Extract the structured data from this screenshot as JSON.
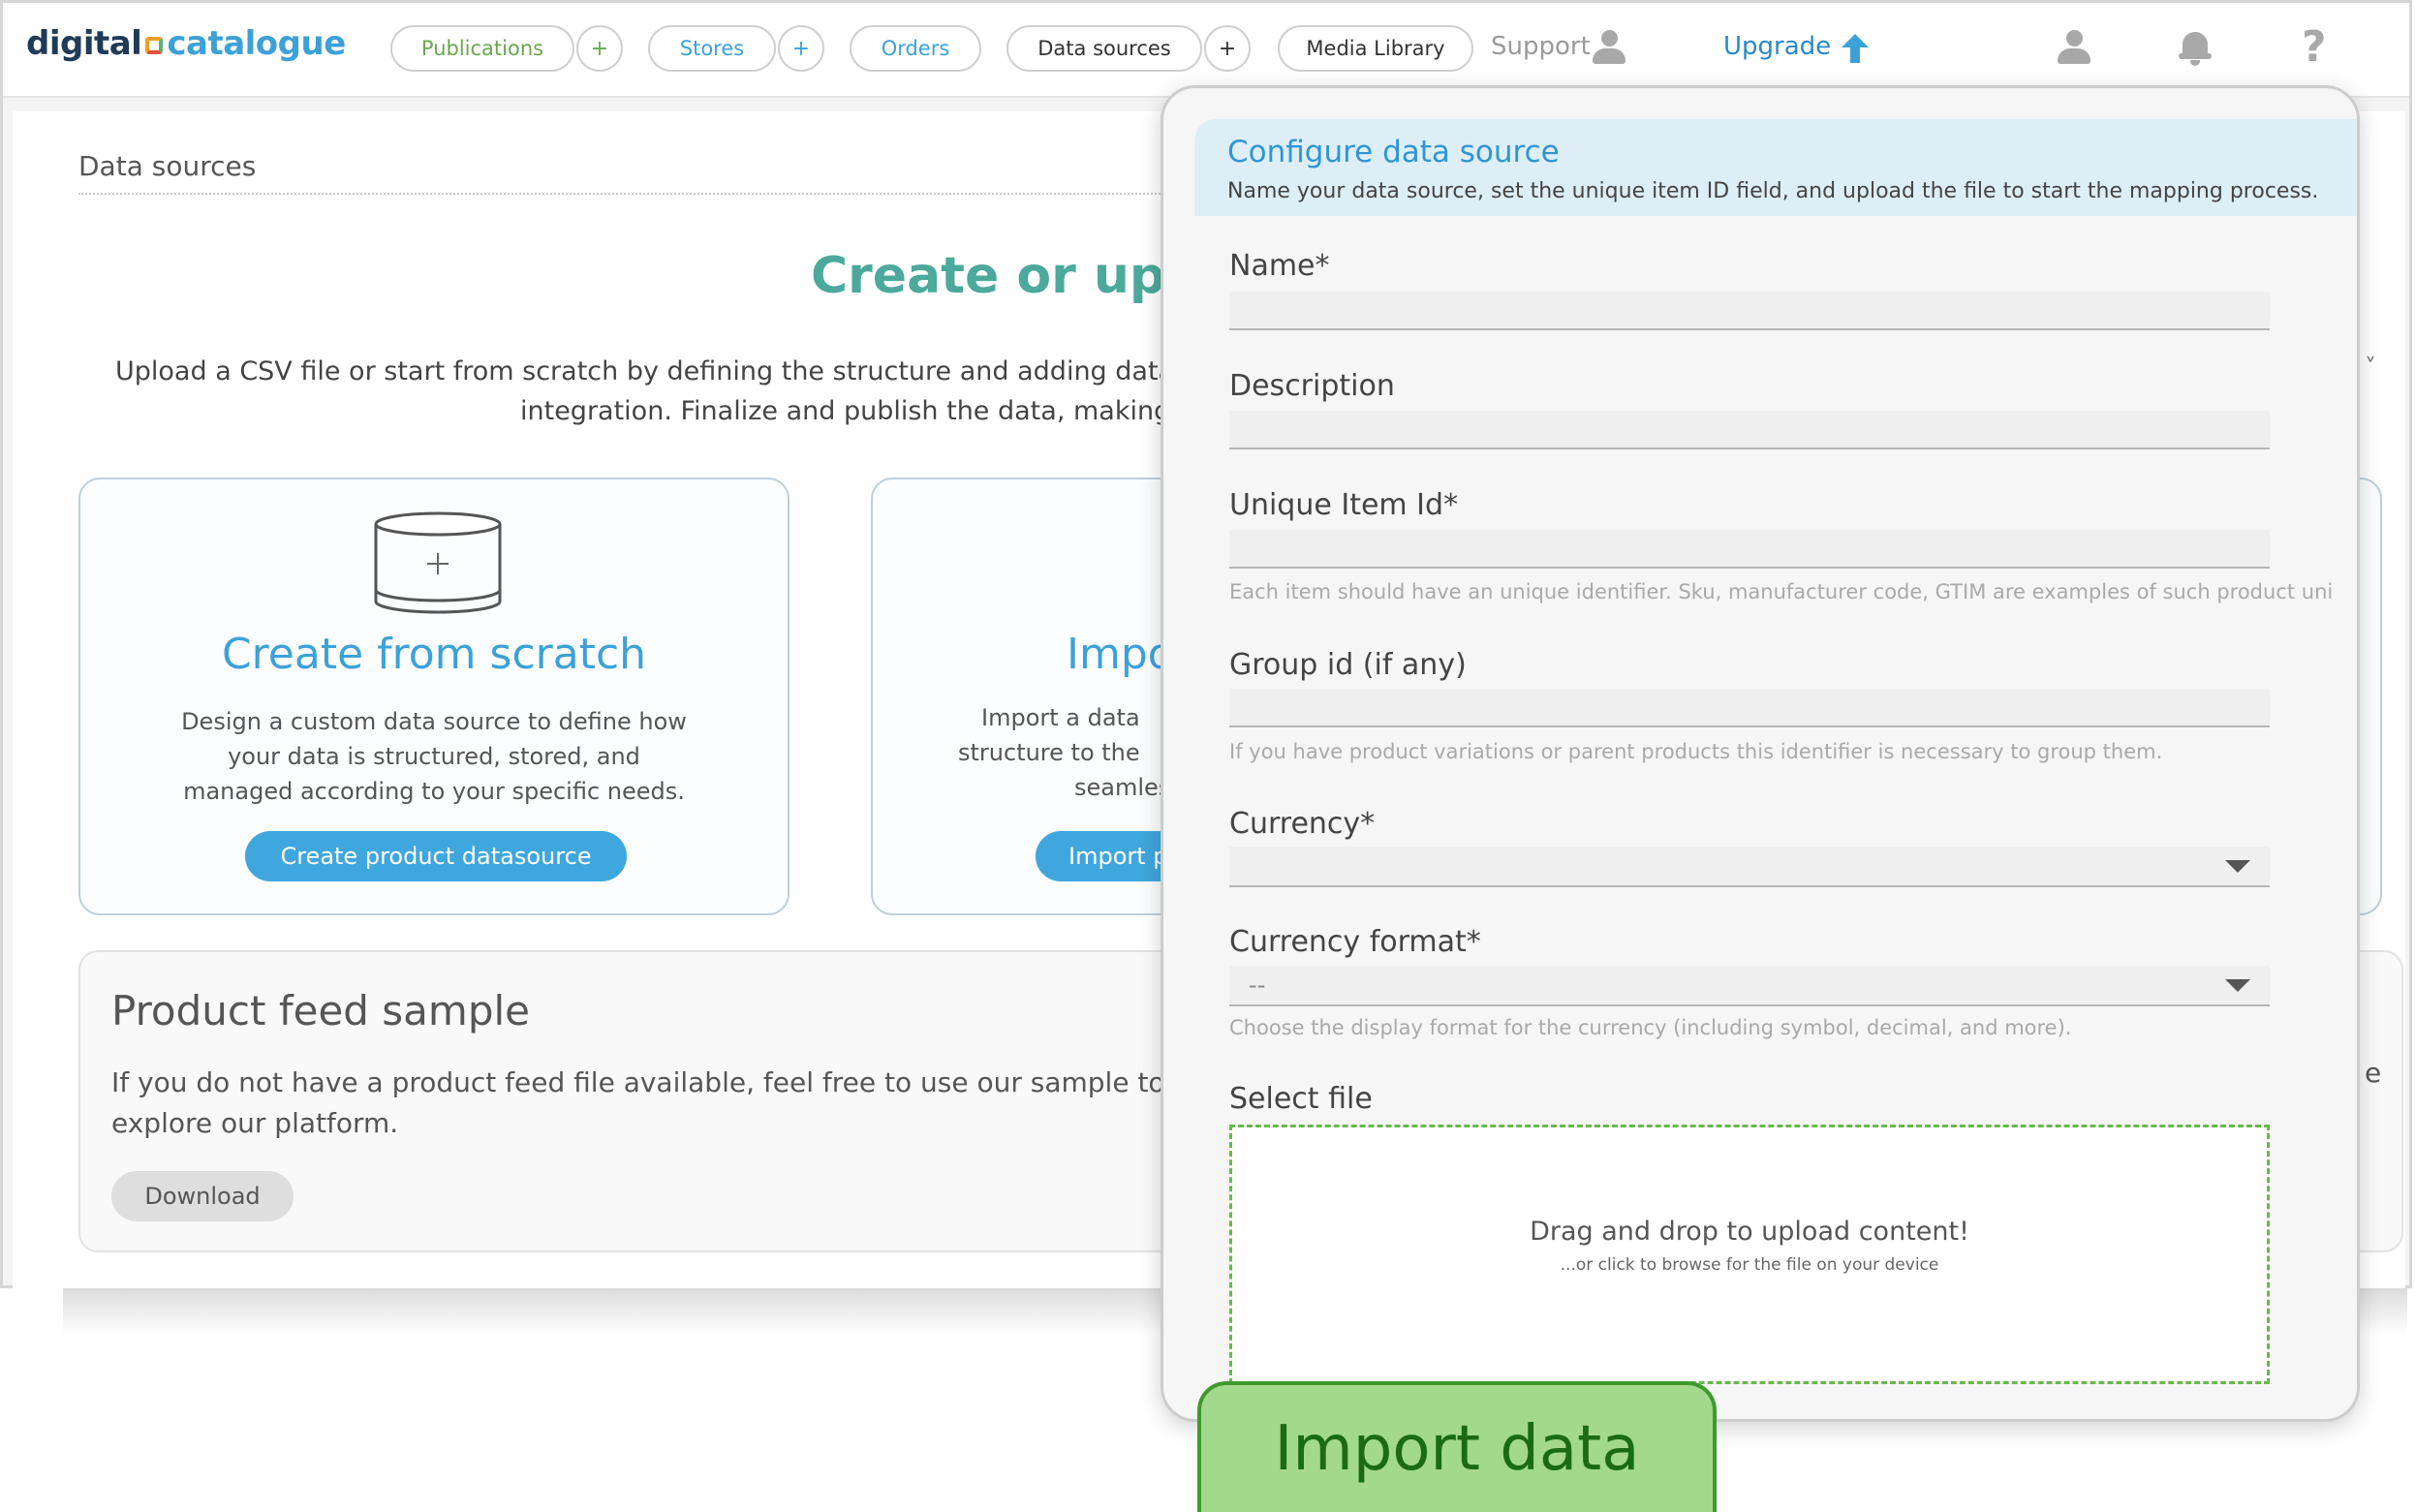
{
  "brand": {
    "part1": "digital",
    "part2": "catalogue"
  },
  "nav": {
    "publications": "Publications",
    "publications_add": "+",
    "stores": "Stores",
    "stores_add": "+",
    "orders": "Orders",
    "data_sources": "Data sources",
    "data_sources_add": "+",
    "media_library": "Media Library",
    "support": "Support",
    "upgrade": "Upgrade",
    "help": "?"
  },
  "colors": {
    "accent_blue": "#3da1d8",
    "hero_teal": "#4ca99b",
    "green_pill": "#6aa84f",
    "upgrade_blue": "#2b88c8",
    "callout_green": "#a2d98c"
  },
  "page": {
    "section_title": "Data sources",
    "hero_title": "Create or uplo",
    "intro_line1": "Upload a CSV file or start from scratch by defining the structure and adding data manual",
    "intro_line2": "integration. Finalize and publish the data, making it avai",
    "chevron": "˅"
  },
  "cards": {
    "scratch": {
      "icon": "database-add-icon",
      "title": "Create from scratch",
      "desc1": "Design a custom data source to define how",
      "desc2": "your data is structured, stored, and",
      "desc3": "managed according to your specific needs.",
      "button": "Create product datasource"
    },
    "import": {
      "title": "Impo",
      "desc1": "Import a data",
      "desc2": "structure to the",
      "desc3": "seamles",
      "button": "Import p"
    }
  },
  "sample": {
    "title": "Product feed sample",
    "text1": "If you do not have a product feed file available, feel free to use our sample to",
    "text2": "explore our platform.",
    "text_tail": "e",
    "button": "Download"
  },
  "modal": {
    "title": "Configure data source",
    "subtitle": "Name your data source, set the unique item ID field, and upload the file to start the mapping process.",
    "name_label": "Name*",
    "name_value": "",
    "description_label": "Description",
    "description_value": "",
    "unique_id_label": "Unique Item Id*",
    "unique_id_value": "",
    "unique_id_help": "Each item should have an unique identifier. Sku, manufacturer code, GTIM are examples of such product uni",
    "group_id_label": "Group id (if any)",
    "group_id_value": "",
    "group_id_help": "If you have product variations or parent products this identifier is necessary to group them.",
    "currency_label": "Currency*",
    "currency_value": "",
    "currency_format_label": "Currency format*",
    "currency_format_value": "--",
    "currency_format_help": "Choose the display format for the currency (including symbol, decimal, and more).",
    "select_file_label": "Select file",
    "dropzone_main": "Drag and drop to upload content!",
    "dropzone_sub": "...or click to browse for the file on your device"
  },
  "callout": {
    "label": "Import data"
  }
}
